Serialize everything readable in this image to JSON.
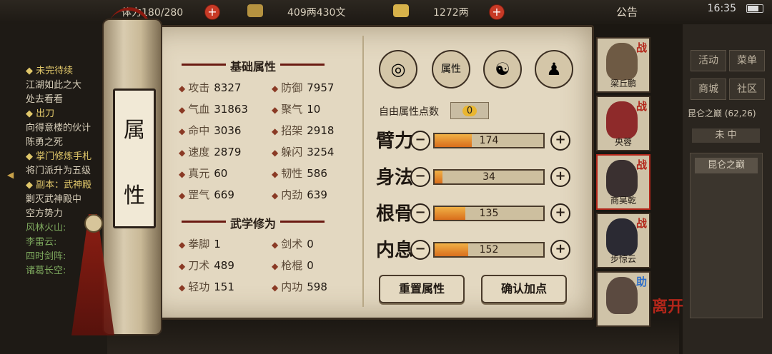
{
  "topbar": {
    "stamina": "体力180/280",
    "money": "409两430文",
    "gold": "1272两",
    "notice": "公告",
    "time": "16:35"
  },
  "quests": [
    {
      "text": "◆ 未完待续",
      "style": "h"
    },
    {
      "text": "江湖如此之大",
      "style": "t"
    },
    {
      "text": "处去看看",
      "style": "t"
    },
    {
      "text": "◆ 出刀",
      "style": "h"
    },
    {
      "text": "向得意楼的伙计",
      "style": "t"
    },
    {
      "text": "陈勇之死",
      "style": "t"
    },
    {
      "text": "◆ 掌门修炼手札",
      "style": "h"
    },
    {
      "text": "将门派升为五级",
      "style": "t"
    },
    {
      "text": "◆ 副本：武神殿",
      "style": "h"
    },
    {
      "text": "剿灭武神殿中",
      "style": "t"
    },
    {
      "text": "空方势力",
      "style": "t"
    },
    {
      "text": "风林火山:",
      "style": "g"
    },
    {
      "text": "李雷云:",
      "style": "g"
    },
    {
      "text": "四时剑阵:",
      "style": "g"
    },
    {
      "text": "诸葛长空:",
      "style": "g"
    }
  ],
  "right_menu": {
    "buttons": [
      "活动",
      "菜单",
      "商城",
      "社区"
    ],
    "location": "昆仑之巅 (62,26)",
    "tab": "未 中",
    "list_item": "昆仑之巅"
  },
  "scroll_label": [
    "属",
    "性"
  ],
  "basic_title": "基础属性",
  "basic_stats": [
    {
      "k": "攻击",
      "v": "8327"
    },
    {
      "k": "防御",
      "v": "7957"
    },
    {
      "k": "气血",
      "v": "31863"
    },
    {
      "k": "聚气",
      "v": "10"
    },
    {
      "k": "命中",
      "v": "3036"
    },
    {
      "k": "招架",
      "v": "2918"
    },
    {
      "k": "速度",
      "v": "2879"
    },
    {
      "k": "躲闪",
      "v": "3254"
    },
    {
      "k": "真元",
      "v": "60"
    },
    {
      "k": "韧性",
      "v": "586"
    },
    {
      "k": "罡气",
      "v": "669"
    },
    {
      "k": "内劲",
      "v": "639"
    }
  ],
  "martial_title": "武学修为",
  "martial_stats": [
    {
      "k": "拳脚",
      "v": "1"
    },
    {
      "k": "剑术",
      "v": "0"
    },
    {
      "k": "刀术",
      "v": "489"
    },
    {
      "k": "枪棍",
      "v": "0"
    },
    {
      "k": "轻功",
      "v": "151"
    },
    {
      "k": "内功",
      "v": "598"
    }
  ],
  "free_points_label": "自由属性点数",
  "free_points": "0",
  "attributes": [
    {
      "name": "臂力",
      "value": "174",
      "fill": 0.34
    },
    {
      "name": "身法",
      "value": "34",
      "fill": 0.07
    },
    {
      "name": "根骨",
      "value": "135",
      "fill": 0.28
    },
    {
      "name": "内息",
      "value": "152",
      "fill": 0.31
    }
  ],
  "icon_tabs": [
    "hat-icon",
    "attribute-book-icon",
    "yin-yang-icon",
    "body-icon"
  ],
  "icon_tab_glyphs": [
    "◎",
    "属性",
    "☯",
    "♟"
  ],
  "reset_button": "重置属性",
  "confirm_button": "确认加点",
  "party": [
    {
      "name": "梁丘鹏",
      "tag": "战",
      "color": "#6e5a44"
    },
    {
      "name": "央蓉",
      "tag": "战",
      "color": "#8e2a2a"
    },
    {
      "name": "商昊乾",
      "tag": "战",
      "color": "#3a3030"
    },
    {
      "name": "步惊云",
      "tag": "战",
      "color": "#2b2a33"
    },
    {
      "name": "",
      "tag": "助",
      "color": "#5b4a40"
    }
  ],
  "leave_label": "离开"
}
